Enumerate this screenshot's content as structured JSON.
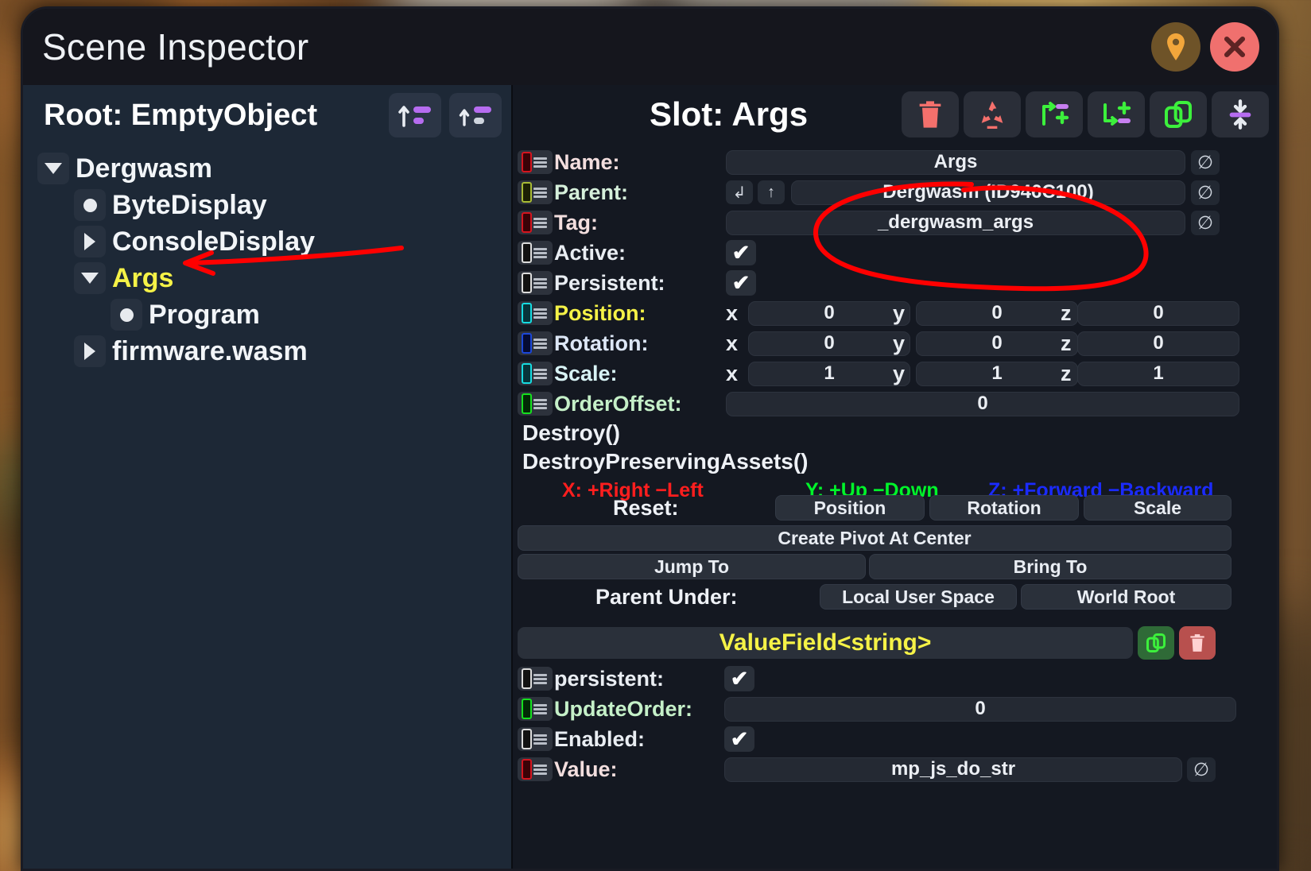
{
  "window": {
    "title": "Scene Inspector",
    "pin_icon": "location-pin-icon",
    "close_icon": "close-icon"
  },
  "tree": {
    "root_label": "Root: EmptyObject",
    "header_buttons": [
      {
        "name": "move-up-hierarchy-button",
        "icon": "arrow-up-list-icon"
      },
      {
        "name": "open-parent-button",
        "icon": "arrow-up-parent-icon"
      }
    ],
    "items": [
      {
        "label": "Dergwasm",
        "indent": 1,
        "toggle": "down",
        "selected": false
      },
      {
        "label": "ByteDisplay",
        "indent": 2,
        "toggle": "dot",
        "selected": false
      },
      {
        "label": "ConsoleDisplay",
        "indent": 2,
        "toggle": "right",
        "selected": false
      },
      {
        "label": "Args",
        "indent": 2,
        "toggle": "down",
        "selected": true
      },
      {
        "label": "Program",
        "indent": 3,
        "toggle": "dot",
        "selected": false
      },
      {
        "label": "firmware.wasm",
        "indent": 2,
        "toggle": "right",
        "selected": false
      }
    ]
  },
  "inspector": {
    "slot_title": "Slot: Args",
    "toolbar": [
      {
        "name": "delete-slot-button",
        "icon": "trash-icon",
        "color": "#f4706c"
      },
      {
        "name": "destroy-preserving-button",
        "icon": "recycle-icon",
        "color": "#f4706c"
      },
      {
        "name": "create-child-button",
        "icon": "add-child-slot-icon",
        "color": "#3cf03c"
      },
      {
        "name": "create-sibling-button",
        "icon": "add-sibling-slot-icon",
        "color": "#3cf03c"
      },
      {
        "name": "duplicate-slot-button",
        "icon": "duplicate-icon",
        "color": "#3cf03c"
      },
      {
        "name": "reorder-slot-button",
        "icon": "move-updown-icon",
        "color": "#c77ff0"
      }
    ],
    "fields": {
      "name": {
        "label": "Name:",
        "value": "Args",
        "swatch": "#cf1320",
        "null_icon": "null-icon"
      },
      "parent": {
        "label": "Parent:",
        "value": "Dergwasm (ID946C100)",
        "swatch": "#9aa732",
        "btn_open": "open-in-new-icon",
        "btn_up": "go-to-parent-icon",
        "null_icon": "null-icon"
      },
      "tag": {
        "label": "Tag:",
        "value": "_dergwasm_args",
        "swatch": "#cf1320",
        "null_icon": "null-icon"
      },
      "active": {
        "label": "Active:",
        "checked": "✔",
        "swatch": "#141414"
      },
      "persistent": {
        "label": "Persistent:",
        "checked": "✔",
        "swatch": "#141414"
      },
      "position": {
        "label": "Position:",
        "swatch": "#18e0e0",
        "x": "0",
        "y": "0",
        "z": "0"
      },
      "rotation": {
        "label": "Rotation:",
        "swatch": "#1b47d8",
        "x": "0",
        "y": "0",
        "z": "0"
      },
      "scale": {
        "label": "Scale:",
        "swatch": "#18e0e0",
        "x": "1",
        "y": "1",
        "z": "1"
      },
      "orderoffset": {
        "label": "OrderOffset:",
        "swatch": "#16e01f",
        "value": "0"
      }
    },
    "axis_labels": {
      "x": "x",
      "y": "y",
      "z": "z"
    },
    "functions": [
      "Destroy()",
      "DestroyPreservingAssets()"
    ],
    "axes_legend": {
      "x": "X: +Right −Left",
      "y": "Y: +Up −Down",
      "z": "Z: +Forward −Backward",
      "x_color": "#ff1e1e",
      "y_color": "#00f42a",
      "z_color": "#1b2bff"
    },
    "reset": {
      "label": "Reset:",
      "buttons": [
        "Position",
        "Rotation",
        "Scale"
      ]
    },
    "pivot_button": "Create Pivot At Center",
    "jump_bring": [
      "Jump To",
      "Bring To"
    ],
    "parent_under": {
      "label": "Parent Under:",
      "buttons": [
        "Local User Space",
        "World Root"
      ]
    },
    "component": {
      "title": "ValueField<string>",
      "duplicate_icon": "duplicate-icon",
      "delete_icon": "trash-icon",
      "fields": {
        "persistent": {
          "label": "persistent:",
          "checked": "✔",
          "swatch": "#141414"
        },
        "updateorder": {
          "label": "UpdateOrder:",
          "value": "0",
          "swatch": "#16e01f"
        },
        "enabled": {
          "label": "Enabled:",
          "checked": "✔",
          "swatch": "#141414"
        },
        "value": {
          "label": "Value:",
          "value": "mp_js_do_str",
          "swatch": "#cf1320",
          "null_icon": "null-icon"
        }
      }
    }
  },
  "annotations": {
    "arrow_color": "#ff0000",
    "circle_color": "#ff0000",
    "arrow_target": "Args",
    "circle_target": "Parent and Tag fields"
  }
}
